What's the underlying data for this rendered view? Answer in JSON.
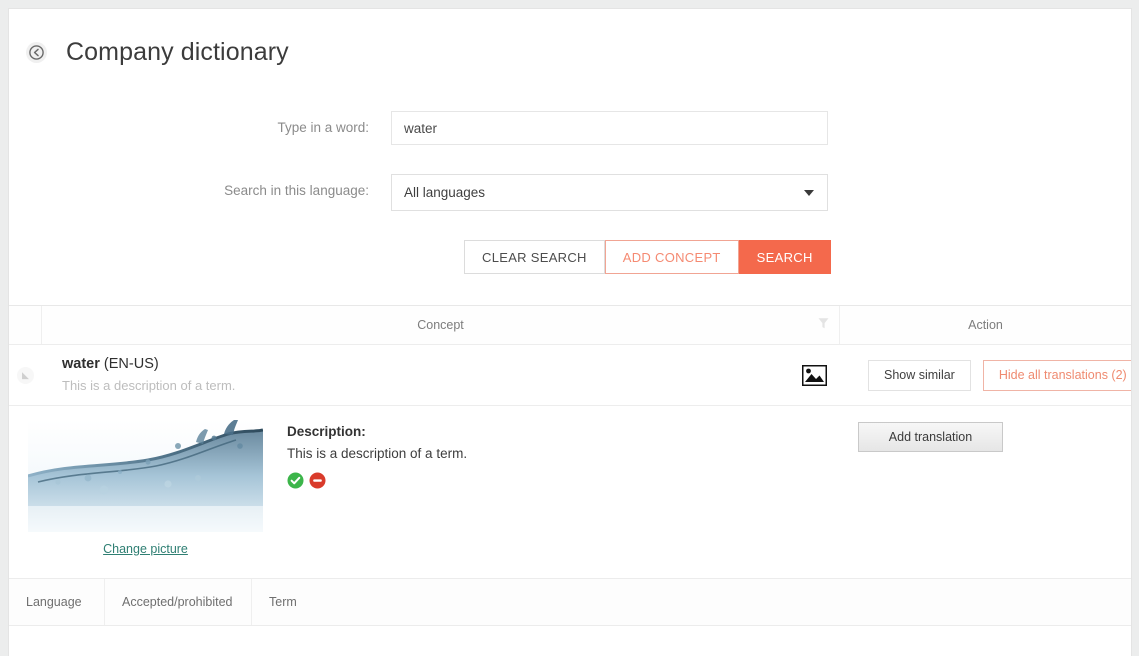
{
  "header": {
    "back_icon": "back-circle-arrow-icon",
    "title": "Company dictionary"
  },
  "search": {
    "word_label": "Type in a word:",
    "word_value": "water",
    "word_placeholder": "Type in a word",
    "language_label": "Search in this language:",
    "language_value": "All languages",
    "buttons": {
      "clear": "CLEAR SEARCH",
      "add_concept": "ADD CONCEPT",
      "search": "SEARCH"
    }
  },
  "results_table": {
    "columns": {
      "concept": "Concept",
      "action": "Action",
      "filter_icon": "filter-funnel-icon"
    },
    "row": {
      "term": "water",
      "language_code": "(EN-US)",
      "description": "This is a description of a term.",
      "picture_icon": "picture-image-icon",
      "show_similar": "Show similar",
      "hide_translations": "Hide all translations (2)"
    }
  },
  "detail": {
    "picture_alt": "water-splash-photo",
    "change_picture": "Change picture",
    "description_label": "Description:",
    "description_text": "This is a description of a term.",
    "status_accepted_icon": "accepted-check-icon",
    "status_prohibited_icon": "prohibited-minus-icon",
    "add_translation": "Add translation"
  },
  "translations_table": {
    "columns": {
      "language": "Language",
      "accepted": "Accepted/prohibited",
      "term": "Term"
    }
  },
  "colors": {
    "accent": "#f4694c",
    "accent_light": "#ef8a70",
    "link": "#2f7f73",
    "accepted": "#3cb54a",
    "prohibited": "#d93b2b"
  }
}
